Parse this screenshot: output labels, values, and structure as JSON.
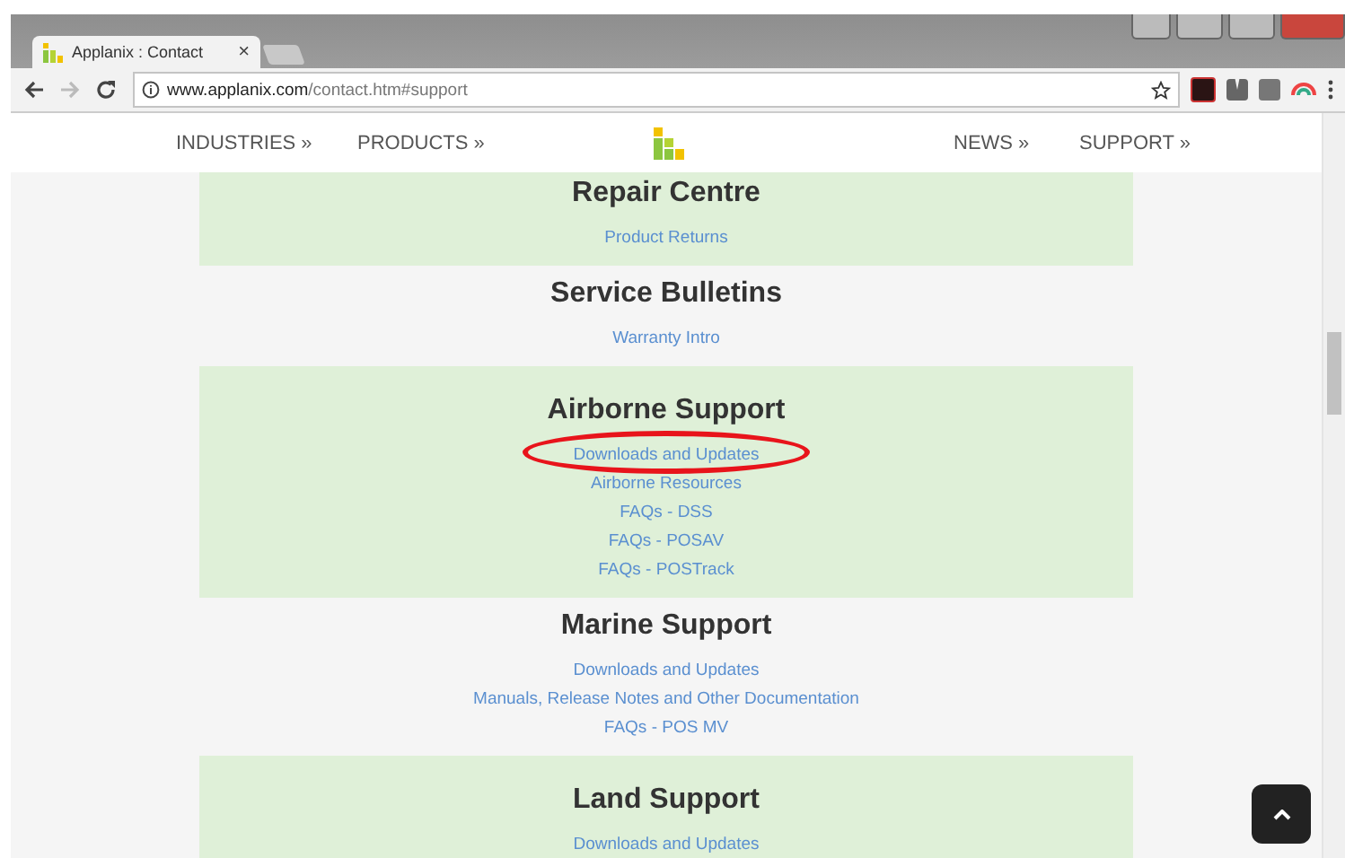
{
  "browser": {
    "tab_title": "Applanix : Contact",
    "tab_close": "×",
    "url_host": "www.applanix.com",
    "url_path": "/contact.htm#support"
  },
  "nav": {
    "items": [
      "INDUSTRIES »",
      "PRODUCTS »",
      "NEWS »",
      "SUPPORT »"
    ]
  },
  "sections": [
    {
      "title": "Repair Centre",
      "shaded": true,
      "links": [
        {
          "label": "Product Returns",
          "circled": false
        }
      ]
    },
    {
      "title": "Service Bulletins",
      "shaded": false,
      "links": [
        {
          "label": "Warranty Intro",
          "circled": false
        }
      ]
    },
    {
      "title": "Airborne Support",
      "shaded": true,
      "links": [
        {
          "label": "Downloads and Updates",
          "circled": true
        },
        {
          "label": "Airborne Resources",
          "circled": false
        },
        {
          "label": "FAQs - DSS",
          "circled": false
        },
        {
          "label": "FAQs - POSAV",
          "circled": false
        },
        {
          "label": "FAQs - POSTrack",
          "circled": false
        }
      ]
    },
    {
      "title": "Marine Support",
      "shaded": false,
      "links": [
        {
          "label": "Downloads and Updates",
          "circled": false
        },
        {
          "label": "Manuals, Release Notes and Other Documentation",
          "circled": false
        },
        {
          "label": "FAQs - POS MV",
          "circled": false
        }
      ]
    },
    {
      "title": "Land Support",
      "shaded": true,
      "links": [
        {
          "label": "Downloads and Updates",
          "circled": false
        }
      ]
    }
  ]
}
